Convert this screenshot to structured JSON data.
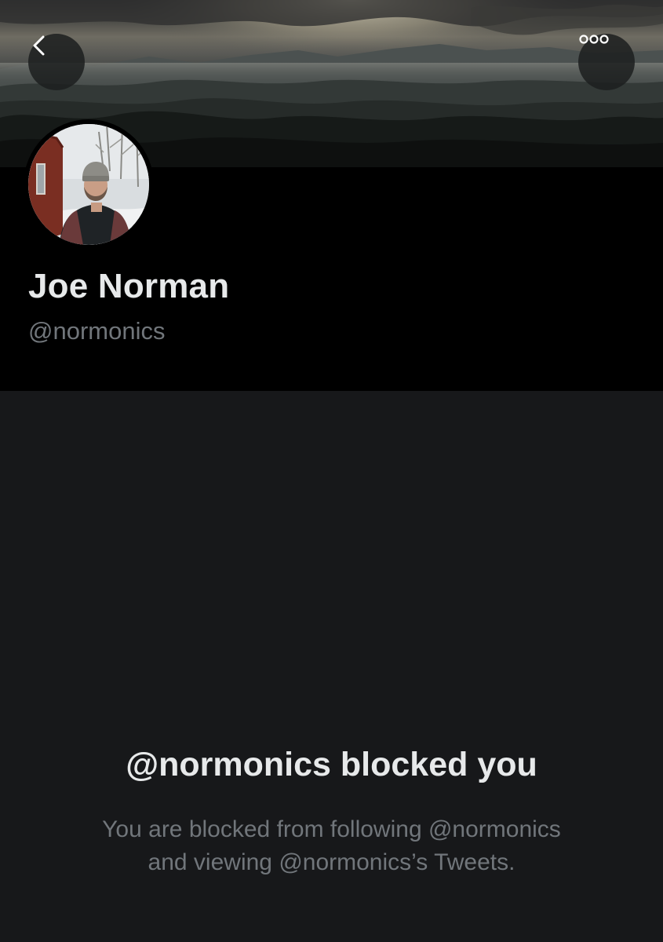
{
  "header": {
    "back_icon": "chevron-left-icon",
    "more_icon": "more-horizontal-icon"
  },
  "profile": {
    "display_name": "Joe Norman",
    "handle": "@normonics"
  },
  "blocked": {
    "title": "@normonics blocked you",
    "description_line1": "You are blocked from following @normonics",
    "description_line2": "and viewing @normonics’s Tweets."
  },
  "colors": {
    "background": "#17181a",
    "profile_background": "#000000",
    "primary_text": "#e7e9ea",
    "secondary_text": "#71767b"
  }
}
